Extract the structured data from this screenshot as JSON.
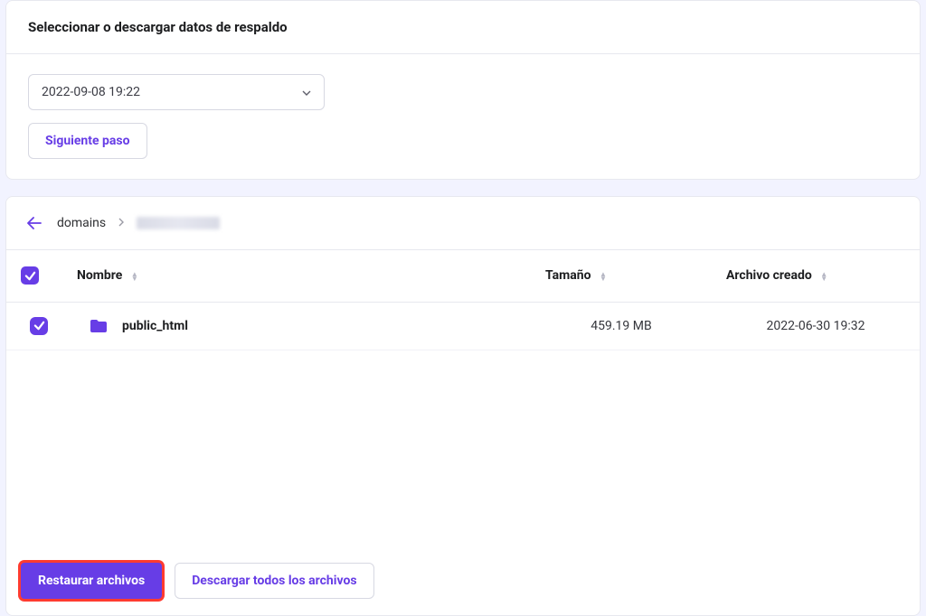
{
  "panel": {
    "title": "Seleccionar o descargar datos de respaldo",
    "backup_selected": "2022-09-08 19:22",
    "next_step": "Siguiente paso"
  },
  "breadcrumb": {
    "root": "domains"
  },
  "table": {
    "headers": {
      "name": "Nombre",
      "size": "Tamaño",
      "created": "Archivo creado"
    },
    "rows": [
      {
        "name": "public_html",
        "size": "459.19 MB",
        "created": "2022-06-30 19:32"
      }
    ]
  },
  "actions": {
    "restore": "Restaurar archivos",
    "download_all": "Descargar todos los archivos"
  }
}
